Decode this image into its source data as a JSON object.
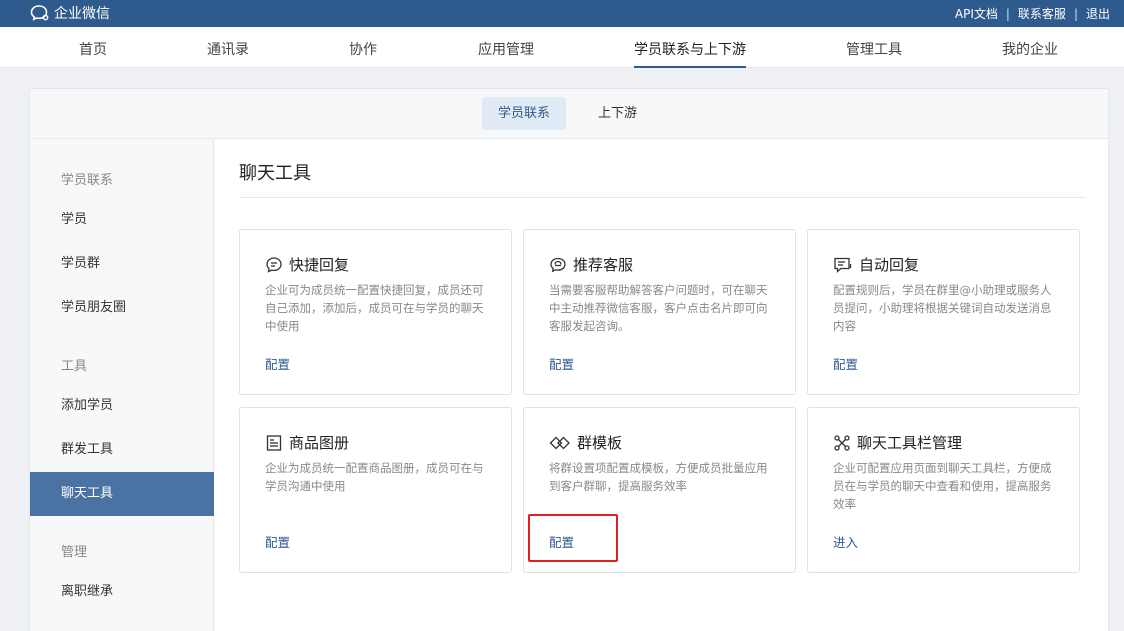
{
  "topbar": {
    "brand": "企业微信",
    "links": [
      "API文档",
      "联系客服",
      "退出"
    ],
    "bg_color": "#2f5a8e"
  },
  "nav": {
    "items": [
      "首页",
      "通讯录",
      "协作",
      "应用管理",
      "学员联系与上下游",
      "管理工具",
      "我的企业"
    ],
    "active": "学员联系与上下游"
  },
  "subtabs": {
    "items": [
      "学员联系",
      "上下游"
    ],
    "active": "学员联系"
  },
  "sidebar": {
    "groups": [
      {
        "title": "学员联系",
        "items": [
          "学员",
          "学员群",
          "学员朋友圈"
        ]
      },
      {
        "title": "工具",
        "items": [
          "添加学员",
          "群发工具",
          "聊天工具"
        ]
      },
      {
        "title": "管理",
        "items": [
          "离职继承"
        ]
      }
    ],
    "active": "聊天工具"
  },
  "content": {
    "title": "聊天工具",
    "cards": [
      {
        "icon": "quick-reply-icon",
        "title": "快捷回复",
        "desc": "企业可为成员统一配置快捷回复，成员还可自己添加，添加后，成员可在与学员的聊天中使用",
        "link": "配置"
      },
      {
        "icon": "customer-service-icon",
        "title": "推荐客服",
        "desc": "当需要客服帮助解答客户问题时，可在聊天中主动推荐微信客服，客户点击名片即可向客服发起咨询。",
        "link": "配置"
      },
      {
        "icon": "auto-reply-icon",
        "title": "自动回复",
        "desc": "配置规则后，学员在群里@小助理或服务人员提问，小助理将根据关键词自动发送消息内容",
        "link": "配置"
      },
      {
        "icon": "product-album-icon",
        "title": "商品图册",
        "desc": "企业为成员统一配置商品图册，成员可在与学员沟通中使用",
        "link": "配置"
      },
      {
        "icon": "group-template-icon",
        "title": "群模板",
        "desc": "将群设置项配置成模板，方便成员批量应用到客户群聊，提高服务效率",
        "link": "配置"
      },
      {
        "icon": "toolbar-manage-icon",
        "title": "聊天工具栏管理",
        "desc": "企业可配置应用页面到聊天工具栏，方便成员在与学员的聊天中查看和使用，提高服务效率",
        "link": "进入"
      }
    ]
  },
  "colors": {
    "accent": "#2f5a8e",
    "sidebar_active": "#4a72a3",
    "highlight": "#e02020"
  }
}
